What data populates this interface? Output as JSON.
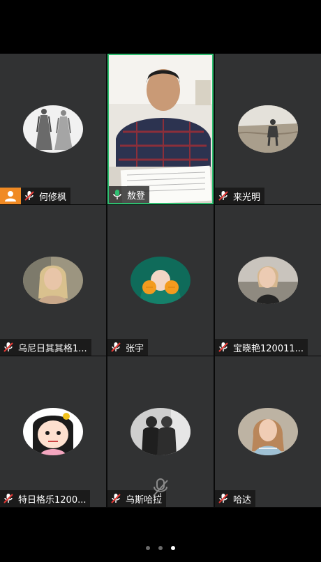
{
  "participants": [
    {
      "name": "何修枫",
      "mic": "muted",
      "host": true,
      "avatar": "fashion-sketch"
    },
    {
      "name": "敖登",
      "mic": "on",
      "host": false,
      "avatar": "video"
    },
    {
      "name": "来光明",
      "mic": "muted",
      "host": false,
      "avatar": "landscape"
    },
    {
      "name": "乌尼日其其格1...",
      "mic": "muted",
      "host": false,
      "avatar": "portrait-blonde"
    },
    {
      "name": "张宇",
      "mic": "muted",
      "host": false,
      "avatar": "portrait-green-hood"
    },
    {
      "name": "宝晓艳120011...",
      "mic": "muted",
      "host": false,
      "avatar": "portrait-woman"
    },
    {
      "name": "特日格乐1200...",
      "mic": "muted",
      "host": false,
      "avatar": "cartoon-girl"
    },
    {
      "name": "乌斯哈拉",
      "mic": "muted",
      "host": false,
      "avatar": "couple"
    },
    {
      "name": "哈达",
      "mic": "muted",
      "host": false,
      "avatar": "portrait-woman-2"
    }
  ],
  "pager": {
    "pages": 3,
    "current": 3
  },
  "colors": {
    "active_speaker_border": "#2fbf71",
    "host_badge": "#f08a24",
    "muted_red": "#e53935"
  }
}
